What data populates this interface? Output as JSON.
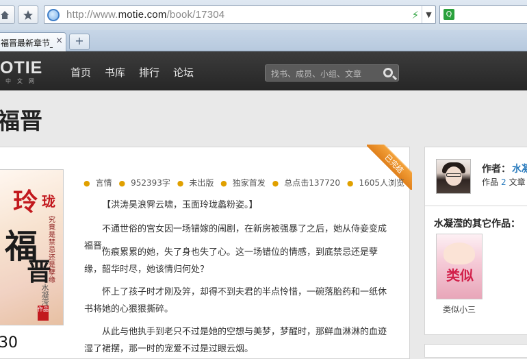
{
  "browser": {
    "url_prefix": "http://www.",
    "url_domain": "motie.com",
    "url_path": "/book/17304",
    "tab_title": "福晋最新章节_原",
    "tab_close": "×",
    "new_tab": "+",
    "search_engine_icon": "Q"
  },
  "site": {
    "logo": "OTIE",
    "logo_sub": "中文网",
    "nav": [
      "首页",
      "书库",
      "排行",
      "论坛"
    ],
    "search_placeholder": "找书、成员、小组、文章"
  },
  "book": {
    "title": "福晋",
    "status_ribbon": "已完结",
    "meta": [
      "言情",
      "952393字",
      "未出版",
      "独家首发",
      "总点击137720",
      "1605人浏览"
    ],
    "paragraphs": [
      "【洪涛昊浪霁云啸，玉面玲珑蠡粉姿。】",
      "不通世俗的宫女因一场错嫁的闹剧，在新房被强暴了之后，她从侍妾变成福晋。",
      "伤痕累累的她，失了身也失了心。这一场错位的情感，到底禁忌还是孽缘，韶华时尽，她该情归何处？",
      "怀上了孩子时才刚及笄，却得不到夫君的半点怜惜，一碗落胎药和一纸休书将她的心狠狠撕碎。",
      "从此与他执手到老只不过是她的空想与美梦，梦醒时，那鲜血淋淋的血迹湿了裙摆，那一时的宠爱不过是过眼云烟。"
    ],
    "bottom_number": "30",
    "cover": {
      "line1": "玲",
      "line1b": "珑",
      "line2": "福",
      "line3": "晋",
      "vertical": "究竟是禁忌还是孽缘",
      "author": "水凝滢",
      "seal": "作品"
    }
  },
  "author": {
    "label": "作者：",
    "name": "水凝",
    "works_label": "作品",
    "works_count": "2",
    "articles_label": "文章"
  },
  "other_works": {
    "heading": "水凝滢的其它作品：",
    "items": [
      {
        "title": "类似小三",
        "cover_text": "类似"
      }
    ]
  },
  "colors": {
    "accent_link": "#2a7bbd",
    "ribbon": "#e58a25",
    "meta_dot": "#e0a000"
  }
}
